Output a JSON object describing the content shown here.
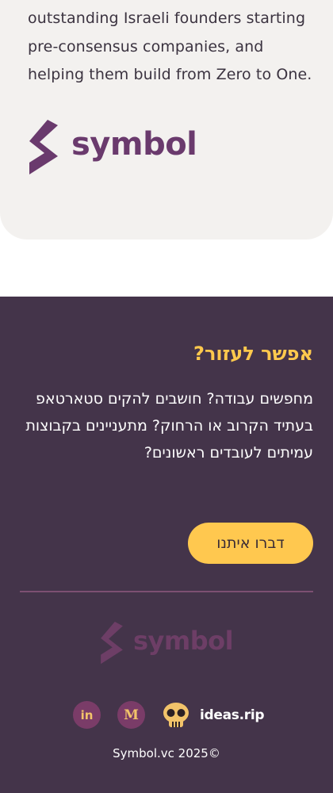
{
  "intro": {
    "text": "outstanding Israeli founders starting pre-consensus companies, and helping them build from Zero to One."
  },
  "brand": {
    "name": "symbol",
    "color_primary": "#6a3a6d",
    "color_footer_logo": "#6d3e66"
  },
  "footer": {
    "background": "#44344a",
    "help_title": "אפשר לעזור?",
    "help_text": "מחפשים עבודה? חושבים להקים סטארטאפ בעתיד הקרוב או הרחוק? מתעניינים בקבוצות עמיתים לעובדים ראשונים?",
    "contact_button": "דברו איתנו",
    "accent": "#ffc84f",
    "socials": [
      {
        "icon": "linkedin-icon",
        "label": "in"
      },
      {
        "icon": "medium-icon",
        "label": "M"
      },
      {
        "icon": "skull-icon",
        "label": ""
      }
    ],
    "ideas_label": "ideas.rip",
    "copyright": "Symbol.vc 2025©"
  }
}
